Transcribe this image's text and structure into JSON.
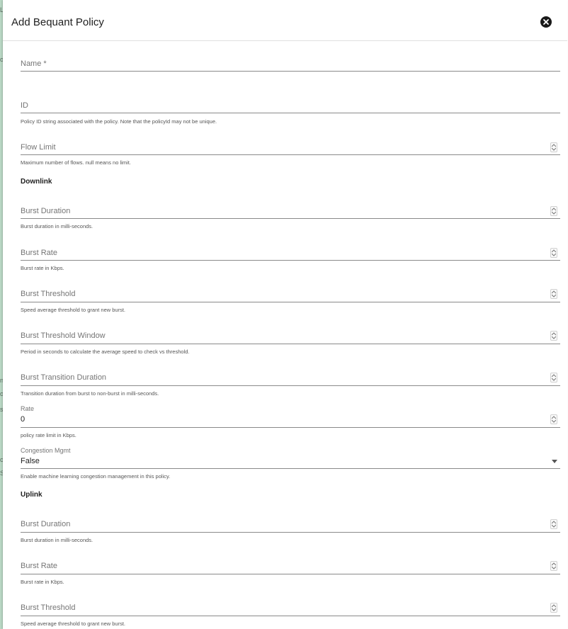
{
  "dialog": {
    "title": "Add Bequant Policy",
    "close_icon": "close-circle-icon"
  },
  "fields": {
    "name": {
      "label": "Name *"
    },
    "id": {
      "label": "ID",
      "hint": "Policy ID string associated with the policy. Note that the policyId may not be unique."
    },
    "flow_limit": {
      "label": "Flow Limit",
      "hint": "Maximum number of flows. null means no limit."
    }
  },
  "downlink": {
    "heading": "Downlink",
    "burst_duration": {
      "label": "Burst Duration",
      "hint": "Burst duration in milli-seconds."
    },
    "burst_rate": {
      "label": "Burst Rate",
      "hint": "Burst rate in Kbps."
    },
    "burst_threshold": {
      "label": "Burst Threshold",
      "hint": "Speed average threshold to grant new burst."
    },
    "burst_threshold_window": {
      "label": "Burst Threshold Window",
      "hint": "Period in seconds to calculate the average speed to check vs threshold."
    },
    "burst_transition_duration": {
      "label": "Burst Transition Duration",
      "hint": "Transition duration from burst to non-burst in milli-seconds."
    },
    "rate": {
      "label": "Rate",
      "value": "0",
      "hint": "policy rate limit in Kbps."
    },
    "congestion_mgmt": {
      "label": "Congestion Mgmt",
      "value": "False",
      "hint": "Enable machine learning congestion management in this policy."
    }
  },
  "uplink": {
    "heading": "Uplink",
    "burst_duration": {
      "label": "Burst Duration",
      "hint": "Burst duration in milli-seconds."
    },
    "burst_rate": {
      "label": "Burst Rate",
      "hint": "Burst rate in Kbps."
    },
    "burst_threshold": {
      "label": "Burst Threshold",
      "hint": "Speed average threshold to grant new burst."
    }
  },
  "colors": {
    "accent": "#212121",
    "underline": "#8a8a8a",
    "background_strip": "#b9d8c4"
  }
}
